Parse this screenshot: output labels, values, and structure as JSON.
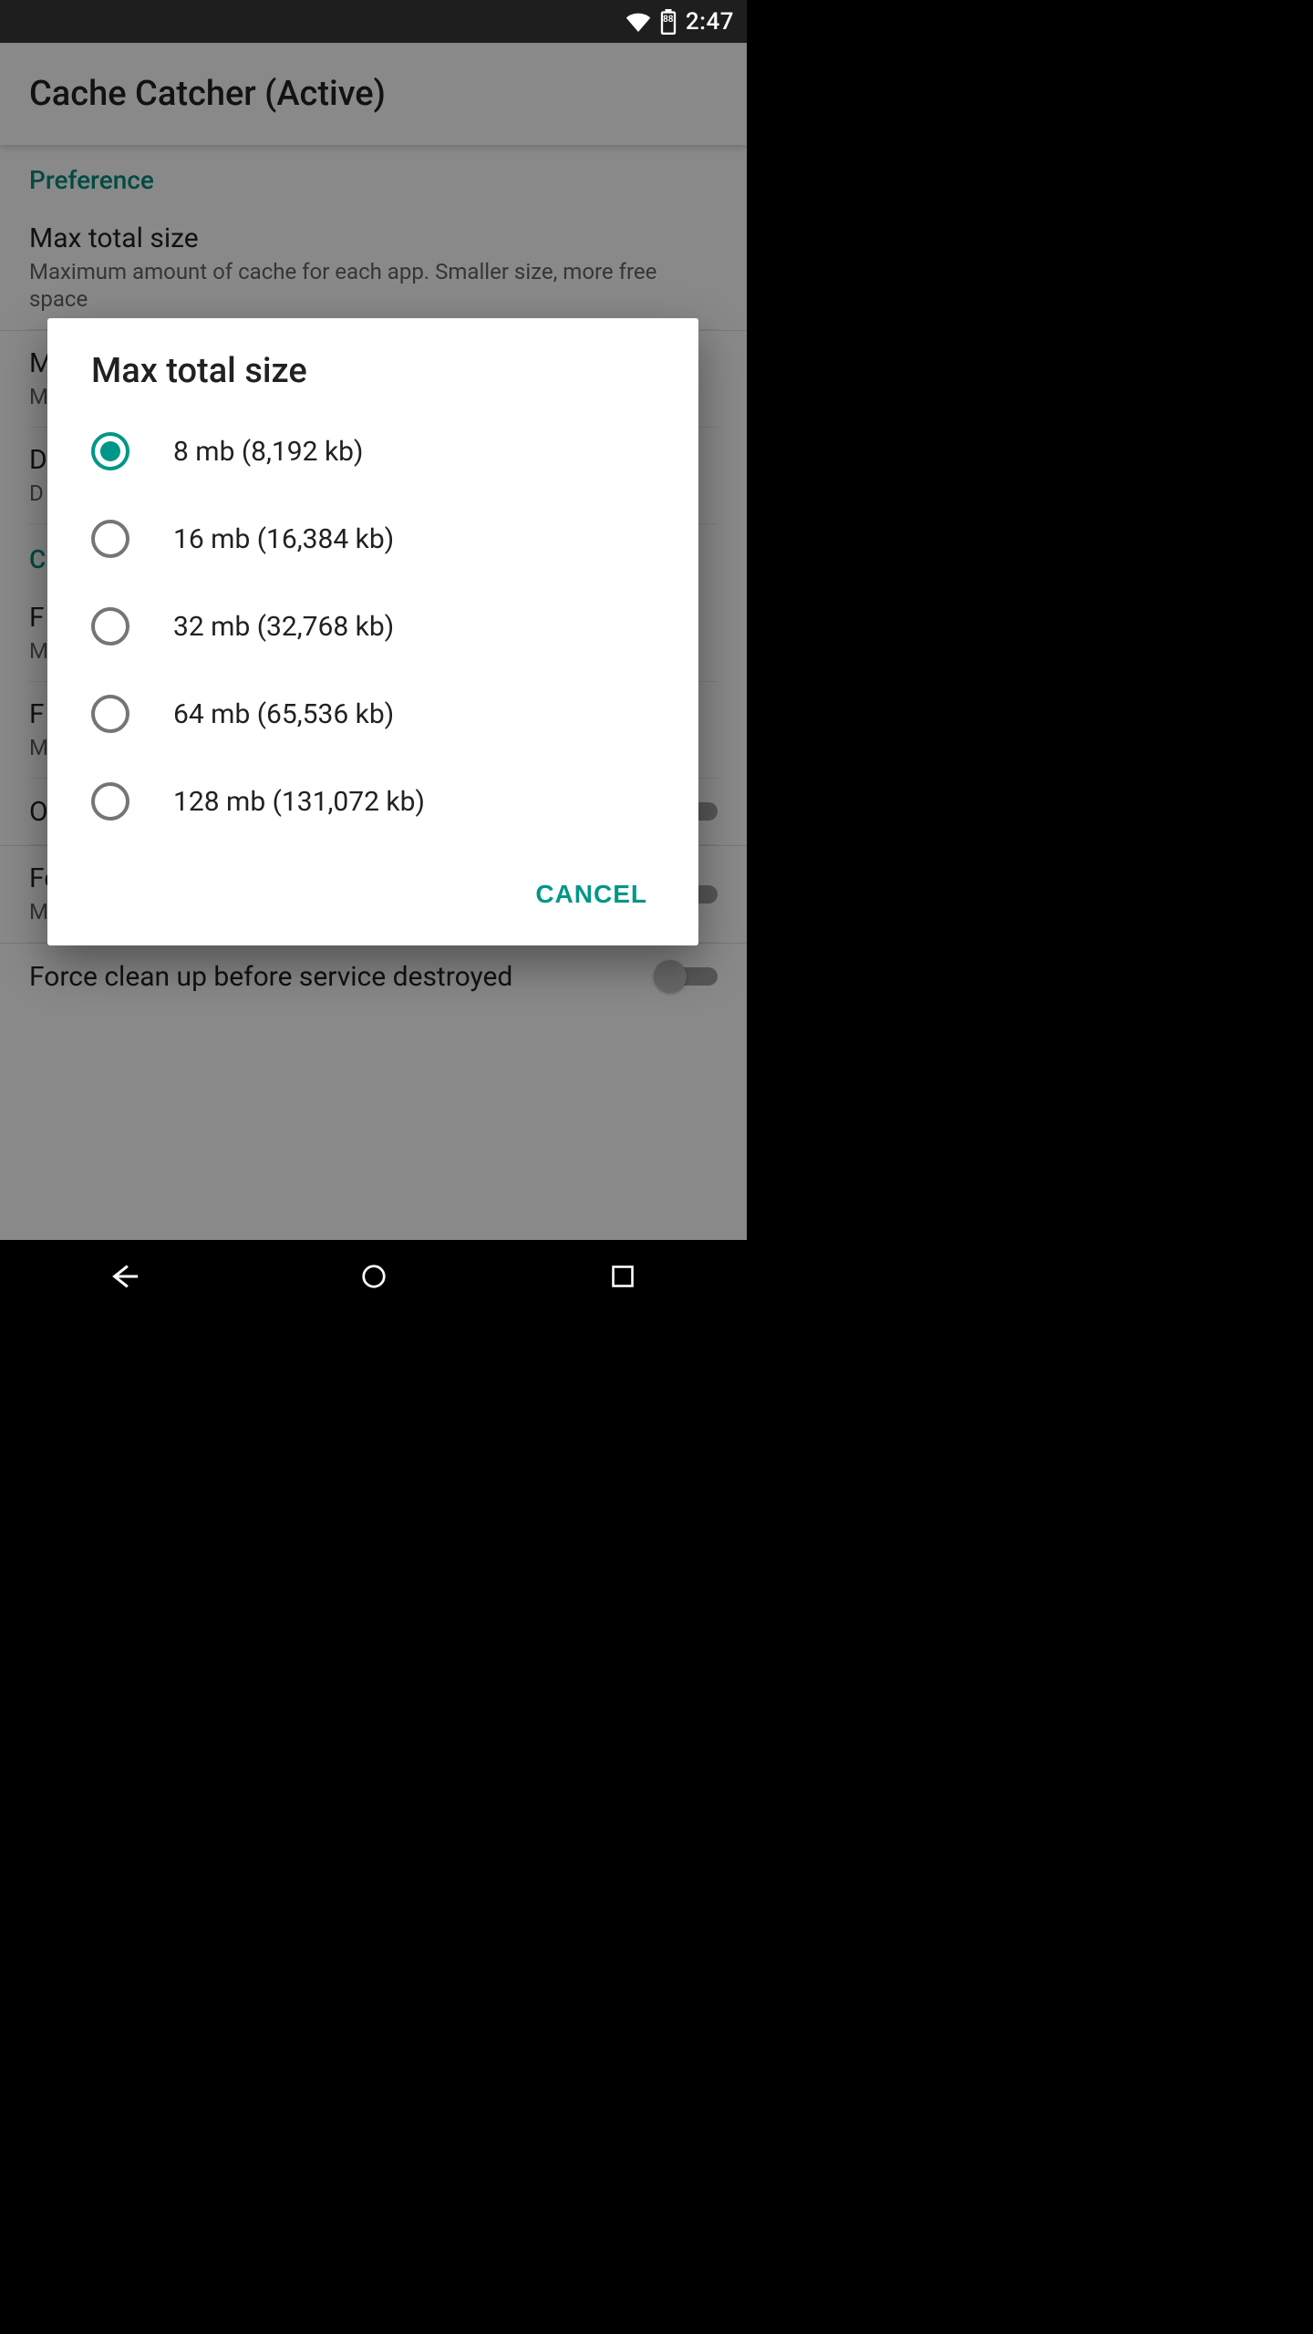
{
  "status": {
    "time": "2:47",
    "battery_pct": 88
  },
  "app": {
    "title": "Cache Catcher (Active)"
  },
  "sections": {
    "preference": {
      "header": "Preference",
      "items": [
        {
          "title": "Max total size",
          "sub": "Maximum amount of cache for each app. Smaller size, more free space"
        },
        {
          "title": "M",
          "sub": "M"
        },
        {
          "title": "D",
          "sub": "D"
        }
      ]
    },
    "c": {
      "header": "C",
      "items": [
        {
          "title": "F",
          "sub": "M"
        },
        {
          "title": "F",
          "sub": "M"
        },
        {
          "title": "Only when destroyed",
          "sub": "",
          "switch": false
        },
        {
          "title": "Force clean up before starting service",
          "sub": "May cause ANR on background service",
          "switch": false
        },
        {
          "title": "Force clean up before service destroyed",
          "sub": "",
          "switch": false
        }
      ]
    }
  },
  "dialog": {
    "title": "Max total size",
    "options": [
      {
        "label": "8 mb (8,192 kb)",
        "selected": true
      },
      {
        "label": "16 mb (16,384 kb)",
        "selected": false
      },
      {
        "label": "32 mb (32,768 kb)",
        "selected": false
      },
      {
        "label": "64 mb (65,536 kb)",
        "selected": false
      },
      {
        "label": "128 mb (131,072 kb)",
        "selected": false
      }
    ],
    "cancel_label": "CANCEL"
  }
}
